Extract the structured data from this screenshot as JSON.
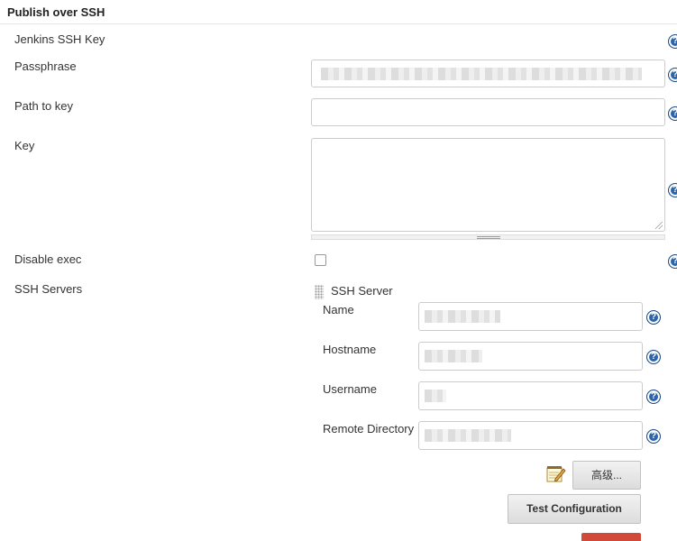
{
  "section": {
    "title": "Publish over SSH"
  },
  "fields": {
    "jenkins_ssh_key": {
      "label": "Jenkins SSH Key"
    },
    "passphrase": {
      "label": "Passphrase"
    },
    "path_to_key": {
      "label": "Path to key",
      "value": ""
    },
    "key": {
      "label": "Key",
      "value": ""
    },
    "disable_exec": {
      "label": "Disable exec",
      "checked": false
    }
  },
  "ssh_servers": {
    "label": "SSH Servers",
    "server": {
      "header": "SSH Server",
      "name": {
        "label": "Name"
      },
      "hostname": {
        "label": "Hostname"
      },
      "username": {
        "label": "Username"
      },
      "remote_directory": {
        "label": "Remote Directory"
      }
    }
  },
  "buttons": {
    "advanced": "高级...",
    "test_configuration": "Test Configuration"
  },
  "icons": {
    "help": "help-icon",
    "advanced": "notepad-edit-icon",
    "drag": "drag-handle-icon"
  },
  "colors": {
    "help_icon": "#2e64a8",
    "delete_button": "#d24939"
  }
}
